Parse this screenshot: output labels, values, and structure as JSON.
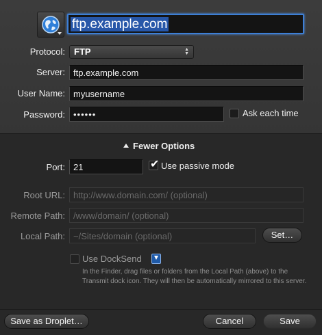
{
  "header": {
    "site_icon": "globe-icon",
    "site_name": "ftp.example.com"
  },
  "form": {
    "protocol_label": "Protocol:",
    "protocol_value": "FTP",
    "server_label": "Server:",
    "server_value": "ftp.example.com",
    "username_label": "User Name:",
    "username_value": "myusername",
    "password_label": "Password:",
    "password_value": "••••••",
    "ask_each_time_label": "Ask each time",
    "ask_each_time_checked": false
  },
  "options": {
    "toggle_label": "Fewer Options",
    "port_label": "Port:",
    "port_value": "21",
    "passive_label": "Use passive mode",
    "passive_checked": true,
    "root_url_label": "Root URL:",
    "root_url_placeholder": "http://www.domain.com/ (optional)",
    "remote_path_label": "Remote Path:",
    "remote_path_placeholder": "/www/domain/ (optional)",
    "local_path_label": "Local Path:",
    "local_path_placeholder": "~/Sites/domain (optional)",
    "set_button": "Set…",
    "docksend_label": "Use DockSend",
    "docksend_checked": false,
    "docksend_help": "In the Finder, drag files or folders from the Local Path (above) to the Transmit dock icon. They will then be automatically mirrored to this server."
  },
  "footer": {
    "save_droplet": "Save as Droplet…",
    "cancel": "Cancel",
    "save": "Save"
  },
  "colors": {
    "accent": "#3d7fd6",
    "selection": "#2757a9",
    "panel_top": "#3a3a3a",
    "panel_bottom": "#282828"
  }
}
